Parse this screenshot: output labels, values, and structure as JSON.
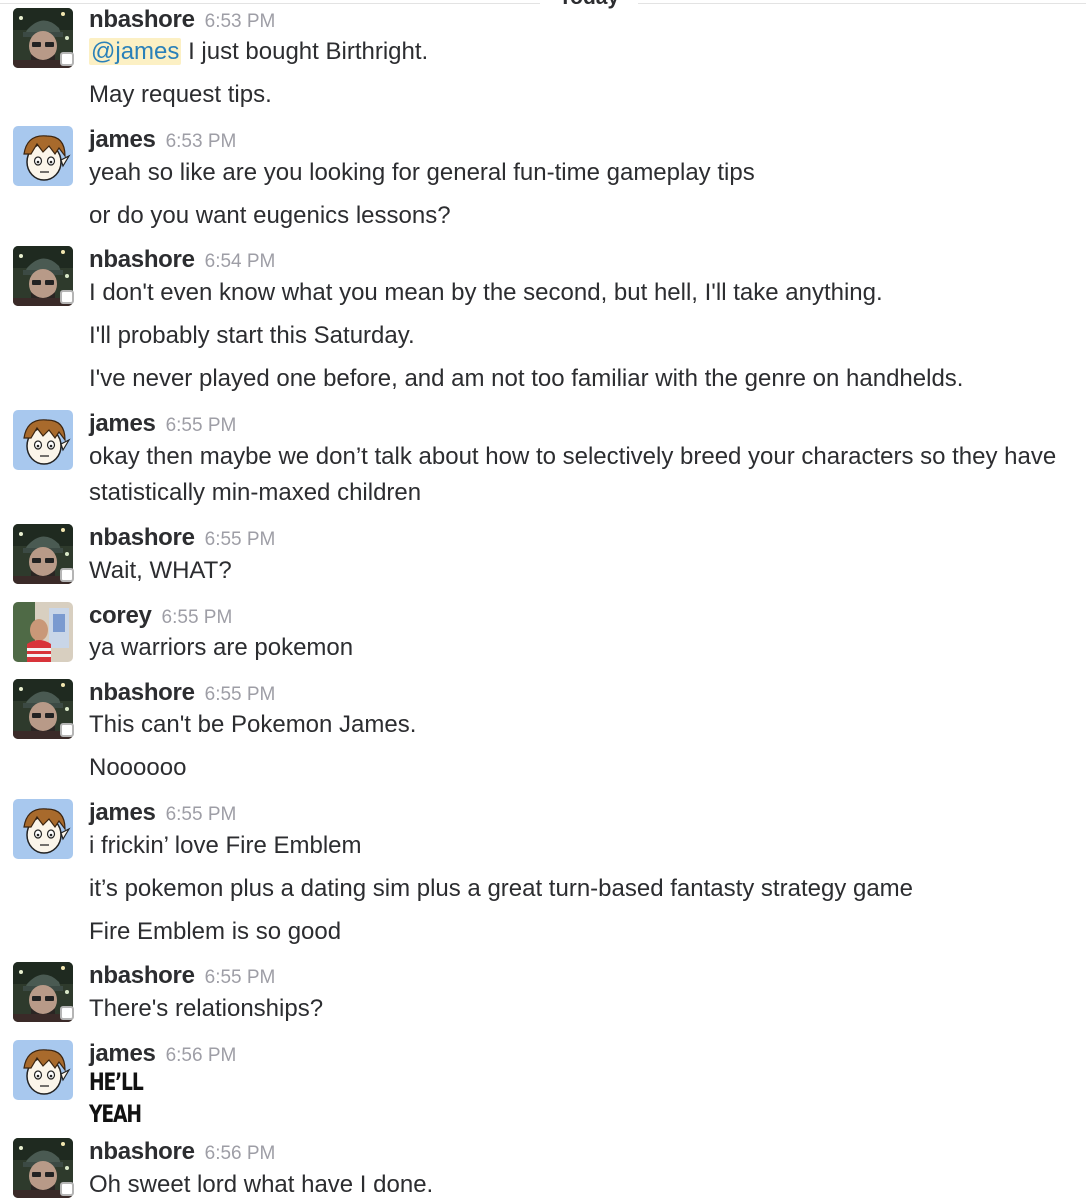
{
  "divider": {
    "label": "Today"
  },
  "messages": [
    {
      "author": "nbashore",
      "time": "6:53 PM",
      "mention": "@james",
      "lines": [
        "I just bought Birthright.",
        "May request tips."
      ]
    },
    {
      "author": "james",
      "time": "6:53 PM",
      "lines": [
        "yeah so like are you looking for general fun-time gameplay tips",
        "or do you want eugenics lessons?"
      ]
    },
    {
      "author": "nbashore",
      "time": "6:54 PM",
      "lines": [
        "I don't even know what you mean by the second, but hell, I'll take anything.",
        "I'll probably start this Saturday.",
        "I've never played one before, and am not too familiar with the genre on handhelds."
      ]
    },
    {
      "author": "james",
      "time": "6:55 PM",
      "lines": [
        "okay then maybe we don’t talk about how to selectively breed your characters so they have",
        "statistically min-maxed children"
      ]
    },
    {
      "author": "nbashore",
      "time": "6:55 PM",
      "lines": [
        "Wait, WHAT?"
      ]
    },
    {
      "author": "corey",
      "time": "6:55 PM",
      "lines": [
        "ya warriors are pokemon"
      ]
    },
    {
      "author": "nbashore",
      "time": "6:55 PM",
      "lines": [
        "This can't be Pokemon James.",
        "Noooooo"
      ]
    },
    {
      "author": "james",
      "time": "6:55 PM",
      "lines": [
        "i frickin’ love Fire Emblem",
        "it’s pokemon plus a dating sim plus a great turn-based fantasty strategy game",
        "Fire Emblem is so good"
      ]
    },
    {
      "author": "nbashore",
      "time": "6:55 PM",
      "lines": [
        "There's relationships?"
      ]
    },
    {
      "author": "james",
      "time": "6:56 PM",
      "lines": [
        "HE’LL",
        "YEAH"
      ]
    },
    {
      "author": "nbashore",
      "time": "6:56 PM",
      "lines": [
        "Oh sweet lord what have I done."
      ]
    }
  ]
}
